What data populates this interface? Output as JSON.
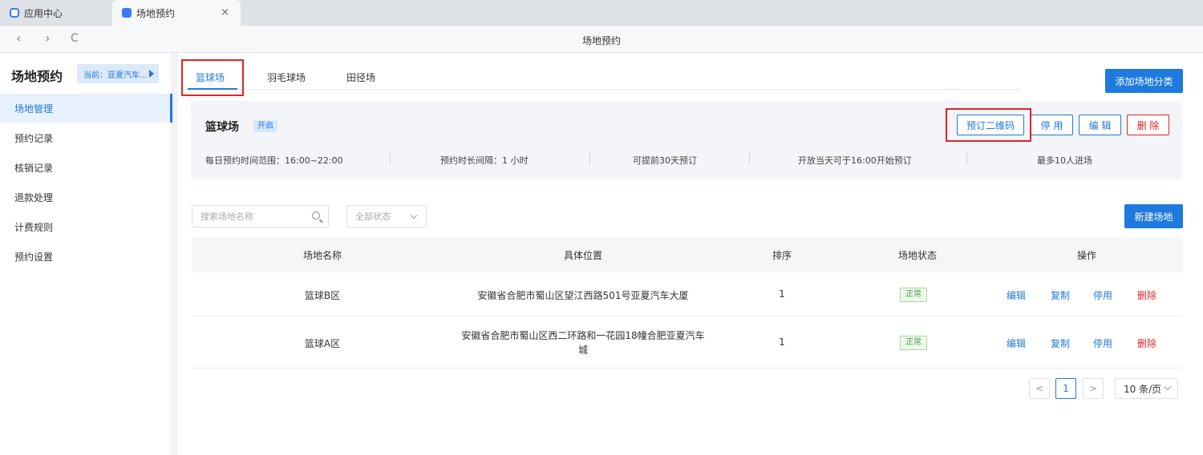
{
  "browser": {
    "tabs": [
      {
        "label": "应用中心",
        "icon": "app-center-icon"
      },
      {
        "label": "场地预约",
        "icon": "app-icon"
      }
    ],
    "close_glyph": "×",
    "nav": {
      "back": "‹",
      "forward": "›",
      "reload": "C"
    },
    "page_title": "场地预约"
  },
  "sidebar": {
    "title": "场地预约",
    "current_badge": "当前：亚夏汽车...",
    "items": [
      {
        "label": "场地管理",
        "active": true
      },
      {
        "label": "预约记录"
      },
      {
        "label": "核销记录"
      },
      {
        "label": "退款处理"
      },
      {
        "label": "计费规则"
      },
      {
        "label": "预约设置"
      }
    ]
  },
  "main": {
    "category_tabs": [
      "篮球场",
      "羽毛球场",
      "田径场"
    ],
    "add_category_button": "添加场地分类",
    "venue": {
      "name": "篮球场",
      "status": "开启",
      "actions": {
        "qr": "预订二维码",
        "disable": "停 用",
        "edit": "编 辑",
        "delete": "删 除"
      },
      "info": [
        "每日预约时间范围：16:00~22:00",
        "预约时长间隔：1 小时",
        "可提前30天预订",
        "开放当天可于16:00开始预订",
        "最多10人进场"
      ]
    },
    "search": {
      "placeholder": "搜索场地名称"
    },
    "status_filter": "全部状态",
    "new_venue_button": "新建场地",
    "table": {
      "headers": [
        "场地名称",
        "具体位置",
        "排序",
        "场地状态",
        "操作"
      ],
      "rows": [
        {
          "name": "篮球B区",
          "location": "安徽省合肥市蜀山区望江西路501号亚夏汽车大厦",
          "location2": "",
          "order": "1",
          "status": "正常"
        },
        {
          "name": "篮球A区",
          "location": "安徽省合肥市蜀山区西二环路和一花园18幢合肥亚夏汽车",
          "location2": "城",
          "order": "1",
          "status": "正常"
        }
      ],
      "row_actions": [
        "编辑",
        "复制",
        "停用",
        "删除"
      ]
    },
    "pagination": {
      "prev": "<",
      "current": "1",
      "next": ">",
      "page_size": "10 条/页"
    }
  },
  "colors": {
    "primary": "#1f7ae0",
    "danger": "#e02424",
    "success": "#3ca53c",
    "highlight_box": "#e02424"
  }
}
